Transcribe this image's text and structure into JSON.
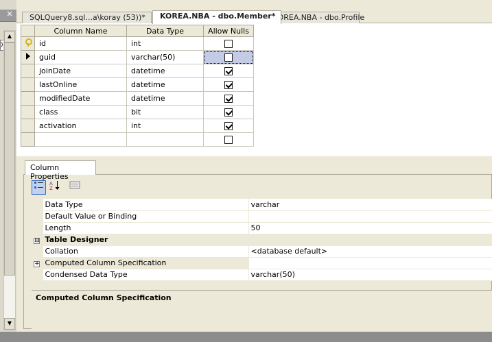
{
  "left": {
    "close_glyph": "×",
    "dropdown_glyph": ")"
  },
  "tabs": [
    {
      "label": "SQLQuery8.sql...a\\koray (53))*",
      "active": false
    },
    {
      "label": "KOREA.NBA - dbo.Member*",
      "active": true
    },
    {
      "label": "KOREA.NBA - dbo.Profile",
      "active": false
    }
  ],
  "grid": {
    "headers": [
      "Column Name",
      "Data Type",
      "Allow Nulls"
    ],
    "rows": [
      {
        "name": "id",
        "type": "int",
        "nulls": false,
        "marker": "key"
      },
      {
        "name": "guid",
        "type": "varchar(50)",
        "nulls": false,
        "marker": "pointer"
      },
      {
        "name": "joinDate",
        "type": "datetime",
        "nulls": true,
        "marker": ""
      },
      {
        "name": "lastOnline",
        "type": "datetime",
        "nulls": true,
        "marker": ""
      },
      {
        "name": "modifiedDate",
        "type": "datetime",
        "nulls": true,
        "marker": ""
      },
      {
        "name": "class",
        "type": "bit",
        "nulls": true,
        "marker": ""
      },
      {
        "name": "activation",
        "type": "int",
        "nulls": true,
        "marker": ""
      },
      {
        "name": "",
        "type": "",
        "nulls": false,
        "marker": ""
      }
    ]
  },
  "properties": {
    "tab_label": "Column Properties",
    "toolbar": {
      "categorized_icon": "categorized-icon",
      "alphabetical_icon": "alphabetical-sort-icon",
      "property_pages_icon": "property-pages-icon"
    },
    "rows": [
      {
        "kind": "prop",
        "name": "Data Type",
        "value": "varchar"
      },
      {
        "kind": "prop",
        "name": "Default Value or Binding",
        "value": ""
      },
      {
        "kind": "prop",
        "name": "Length",
        "value": "50"
      },
      {
        "kind": "cat",
        "name": "Table Designer",
        "expander": "⊟"
      },
      {
        "kind": "prop",
        "name": "Collation",
        "value": "<database default>"
      },
      {
        "kind": "sub",
        "name": "Computed Column Specification",
        "value": "",
        "expander": "+"
      },
      {
        "kind": "prop",
        "name": "Condensed Data Type",
        "value": "varchar(50)"
      }
    ],
    "description_title": "Computed Column Specification"
  },
  "colors": {
    "selection": "#c3cbe6",
    "chrome": "#ece9d8",
    "border": "#aca899"
  }
}
